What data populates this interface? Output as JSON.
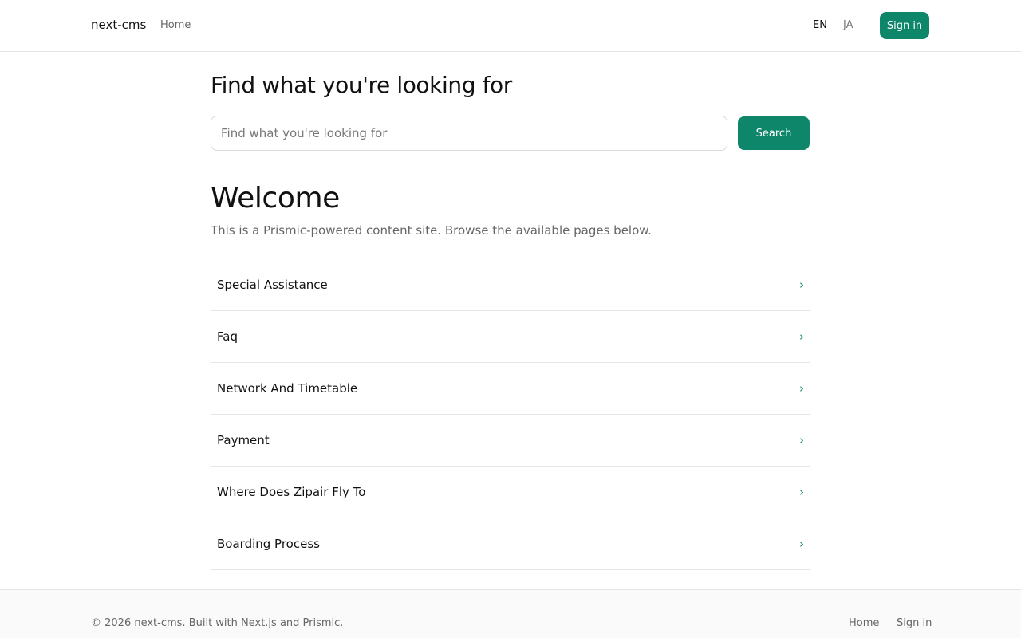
{
  "header": {
    "brand": "next-cms",
    "nav_home": "Home",
    "languages": [
      {
        "label": "EN",
        "active": true
      },
      {
        "label": "JA",
        "active": false
      }
    ],
    "signin_label": "Sign in"
  },
  "search": {
    "title": "Find what you're looking for",
    "placeholder": "Find what you're looking for",
    "value": "",
    "button_label": "Search"
  },
  "welcome": {
    "title": "Welcome",
    "subtitle": "This is a Prismic-powered content site. Browse the available pages below."
  },
  "pages": [
    {
      "label": "Special Assistance",
      "chevron": "›"
    },
    {
      "label": "Faq",
      "chevron": "›"
    },
    {
      "label": "Network And Timetable",
      "chevron": "›"
    },
    {
      "label": "Payment",
      "chevron": "›"
    },
    {
      "label": "Where Does Zipair Fly To",
      "chevron": "›"
    },
    {
      "label": "Boarding Process",
      "chevron": "›"
    }
  ],
  "footer": {
    "copyright": "© 2026 next-cms. Built with Next.js and Prismic.",
    "home_label": "Home",
    "signin_label": "Sign in"
  },
  "colors": {
    "accent": "#0e866a",
    "border": "#e5e5e5",
    "muted_text": "#666666",
    "footer_bg": "#fafafa"
  },
  "icons": {
    "chevron": "chevron-right-icon"
  }
}
